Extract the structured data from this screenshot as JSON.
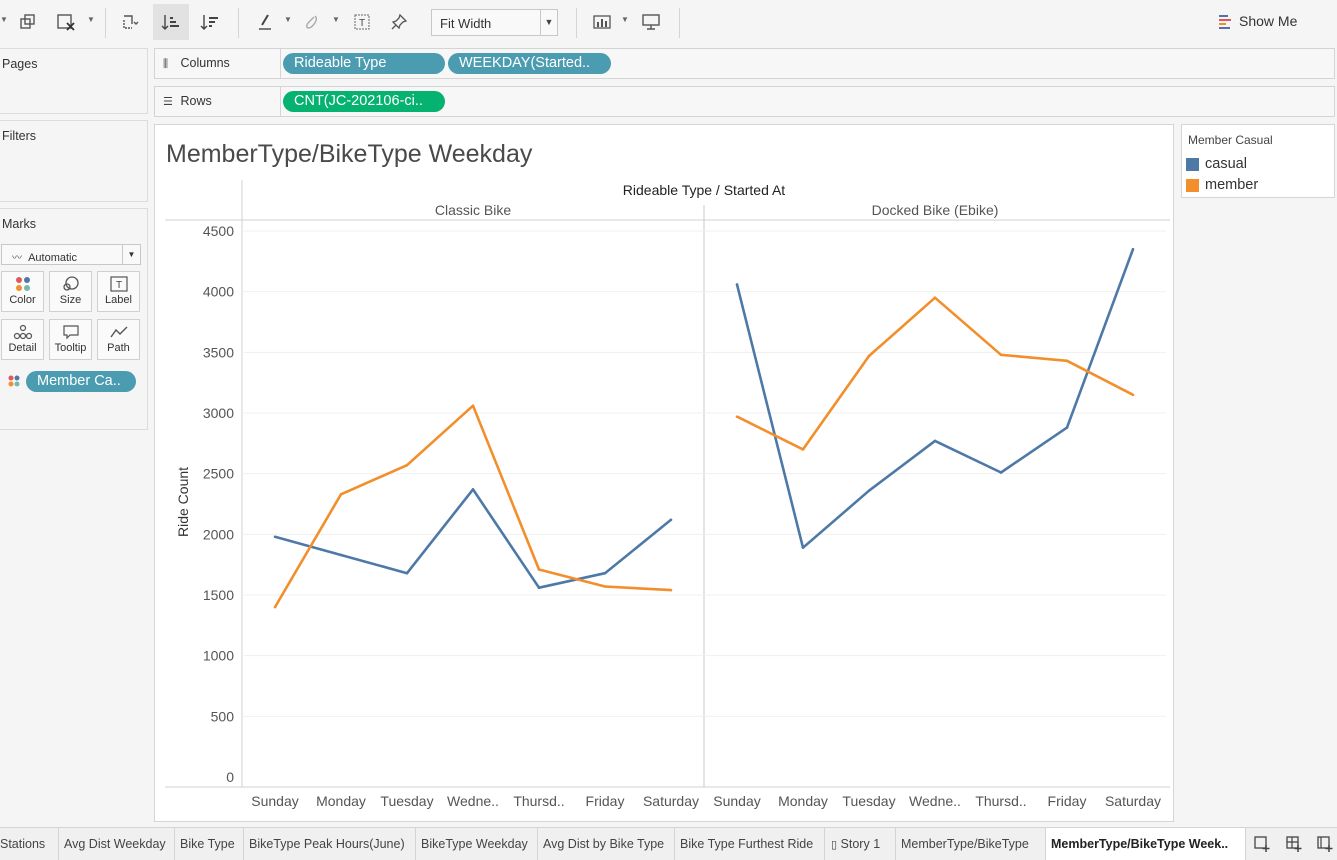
{
  "toolbar": {
    "fit_width": "Fit Width",
    "show_me": "Show Me",
    "icons": [
      "duplicate-sheet-icon",
      "clear-sheet-icon",
      "swap-icon",
      "sort-ascending-icon",
      "sort-descending-icon",
      "highlight-icon",
      "group-icon",
      "label-icon",
      "pin-icon",
      "show-cards-icon",
      "presentation-icon"
    ]
  },
  "left_panel": {
    "pages_title": "Pages",
    "filters_title": "Filters",
    "marks_title": "Marks",
    "mark_type": "Automatic",
    "mark_cards": [
      {
        "label": "Color",
        "icon": "color-icon"
      },
      {
        "label": "Size",
        "icon": "size-icon"
      },
      {
        "label": "Label",
        "icon": "label-icon"
      },
      {
        "label": "Detail",
        "icon": "detail-icon"
      },
      {
        "label": "Tooltip",
        "icon": "tooltip-icon"
      },
      {
        "label": "Path",
        "icon": "path-icon"
      }
    ],
    "color_pill": "Member Ca.."
  },
  "shelves": {
    "columns_label": "Columns",
    "rows_label": "Rows",
    "columns_pills": [
      "Rideable Type",
      "WEEKDAY(Started.."
    ],
    "rows_pills": [
      "CNT(JC-202106-ci.."
    ]
  },
  "view": {
    "title": "MemberType/BikeType Weekday"
  },
  "legend": {
    "title": "Member Casual",
    "items": [
      {
        "label": "casual",
        "color": "#4e79a7"
      },
      {
        "label": "member",
        "color": "#f28e2b"
      }
    ]
  },
  "chart_data": {
    "type": "line",
    "header": "Rideable Type",
    "header_sub": "Started At",
    "ylabel": "Ride Count",
    "ylim": [
      0,
      4500
    ],
    "yticks": [
      0,
      500,
      1000,
      1500,
      2000,
      2500,
      3000,
      3500,
      4000,
      4500
    ],
    "categories": [
      "Sunday",
      "Monday",
      "Tuesday",
      "Wedne..",
      "Thursd..",
      "Friday",
      "Saturday"
    ],
    "panels": [
      {
        "name": "Classic Bike",
        "series": [
          {
            "name": "casual",
            "color": "#4e79a7",
            "values": [
              1980,
              1830,
              1680,
              2370,
              1560,
              1680,
              2120
            ]
          },
          {
            "name": "member",
            "color": "#f28e2b",
            "values": [
              1400,
              2330,
              2570,
              3060,
              1710,
              1570,
              1540
            ]
          }
        ]
      },
      {
        "name": "Docked Bike (Ebike)",
        "series": [
          {
            "name": "casual",
            "color": "#4e79a7",
            "values": [
              4060,
              1890,
              2360,
              2770,
              2510,
              2880,
              4350
            ]
          },
          {
            "name": "member",
            "color": "#f28e2b",
            "values": [
              2970,
              2700,
              3470,
              3950,
              3480,
              3430,
              3150
            ]
          }
        ]
      }
    ]
  },
  "tabs": [
    {
      "label": "Stations"
    },
    {
      "label": "Avg Dist Weekday"
    },
    {
      "label": "Bike Type"
    },
    {
      "label": "BikeType Peak Hours(June)"
    },
    {
      "label": "BikeType Weekday"
    },
    {
      "label": "Avg Dist by Bike Type"
    },
    {
      "label": "Bike Type Furthest Ride"
    },
    {
      "label": "Story 1"
    },
    {
      "label": "MemberType/BikeType"
    },
    {
      "label": "MemberType/BikeType Week.."
    }
  ]
}
